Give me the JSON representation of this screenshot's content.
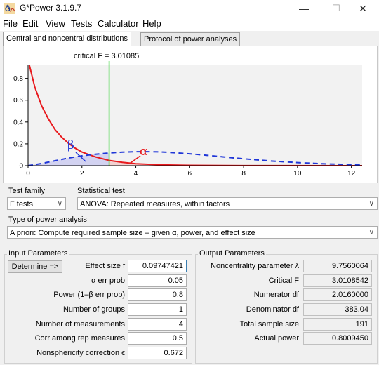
{
  "window": {
    "title": "G*Power 3.1.9.7",
    "minimize": "—",
    "maximize": "☐",
    "close": "✕"
  },
  "menu": [
    "File",
    "Edit",
    "View",
    "Tests",
    "Calculator",
    "Help"
  ],
  "tabs": [
    "Central and noncentral distributions",
    "Protocol of power analyses"
  ],
  "plot": {
    "critical_label": "critical F = 3.01085",
    "beta_symbol": "β",
    "alpha_symbol": "α",
    "x_ticks": [
      "0",
      "2",
      "4",
      "6",
      "8",
      "10",
      "12"
    ],
    "y_ticks": [
      "0",
      "0.2",
      "0.4",
      "0.6",
      "0.8"
    ]
  },
  "chart_data": {
    "type": "line",
    "xlim": [
      0,
      12.4
    ],
    "ylim": [
      0,
      0.92
    ],
    "critical_f": 3.01085,
    "x_ticks": [
      0,
      2,
      4,
      6,
      8,
      10,
      12
    ],
    "y_ticks": [
      0,
      0.2,
      0.4,
      0.6,
      0.8
    ],
    "central_curve": {
      "color": "#e8191d",
      "points": [
        [
          0.05,
          0.92
        ],
        [
          0.25,
          0.72
        ],
        [
          0.5,
          0.55
        ],
        [
          0.75,
          0.43
        ],
        [
          1.0,
          0.33
        ],
        [
          1.25,
          0.26
        ],
        [
          1.5,
          0.205
        ],
        [
          1.75,
          0.16
        ],
        [
          2.0,
          0.125
        ],
        [
          2.5,
          0.08
        ],
        [
          3.0,
          0.048
        ],
        [
          3.5,
          0.03
        ],
        [
          4.0,
          0.018
        ],
        [
          5.0,
          0.007
        ],
        [
          6.0,
          0.003
        ],
        [
          8.0,
          0.0005
        ],
        [
          12.4,
          0.0
        ]
      ]
    },
    "noncentral_curve": {
      "color": "#1f36d8",
      "points": [
        [
          0,
          0.0
        ],
        [
          0.5,
          0.02
        ],
        [
          1.0,
          0.045
        ],
        [
          1.5,
          0.07
        ],
        [
          2.0,
          0.09
        ],
        [
          2.5,
          0.105
        ],
        [
          3.0,
          0.116
        ],
        [
          3.5,
          0.124
        ],
        [
          4.0,
          0.128
        ],
        [
          4.5,
          0.128
        ],
        [
          5.0,
          0.125
        ],
        [
          5.5,
          0.118
        ],
        [
          6.0,
          0.109
        ],
        [
          6.5,
          0.098
        ],
        [
          7.0,
          0.086
        ],
        [
          7.5,
          0.074
        ],
        [
          8.0,
          0.063
        ],
        [
          9.0,
          0.043
        ],
        [
          10.0,
          0.028
        ],
        [
          11.0,
          0.017
        ],
        [
          12.0,
          0.01
        ],
        [
          12.4,
          0.008
        ]
      ]
    }
  },
  "test_family": {
    "label": "Test family",
    "value": "F tests"
  },
  "statistical_test": {
    "label": "Statistical test",
    "value": "ANOVA: Repeated measures, within factors"
  },
  "power_analysis": {
    "label": "Type of power analysis",
    "value": "A priori: Compute required sample size – given α, power, and effect size"
  },
  "input": {
    "title": "Input Parameters",
    "determine_label": "Determine =>",
    "rows": [
      {
        "label": "Effect size f",
        "value": "0.09747421"
      },
      {
        "label": "α err prob",
        "value": "0.05"
      },
      {
        "label": "Power (1–β err prob)",
        "value": "0.8"
      },
      {
        "label": "Number of groups",
        "value": "1"
      },
      {
        "label": "Number of measurements",
        "value": "4"
      },
      {
        "label": "Corr among rep measures",
        "value": "0.5"
      },
      {
        "label": "Nonsphericity correction ϵ",
        "value": "0.672"
      }
    ]
  },
  "output": {
    "title": "Output Parameters",
    "rows": [
      {
        "label": "Noncentrality parameter λ",
        "value": "9.7560064"
      },
      {
        "label": "Critical F",
        "value": "3.0108542"
      },
      {
        "label": "Numerator df",
        "value": "2.0160000"
      },
      {
        "label": "Denominator df",
        "value": "383.04"
      },
      {
        "label": "Total sample size",
        "value": "191"
      },
      {
        "label": "Actual power",
        "value": "0.8009450"
      }
    ]
  }
}
